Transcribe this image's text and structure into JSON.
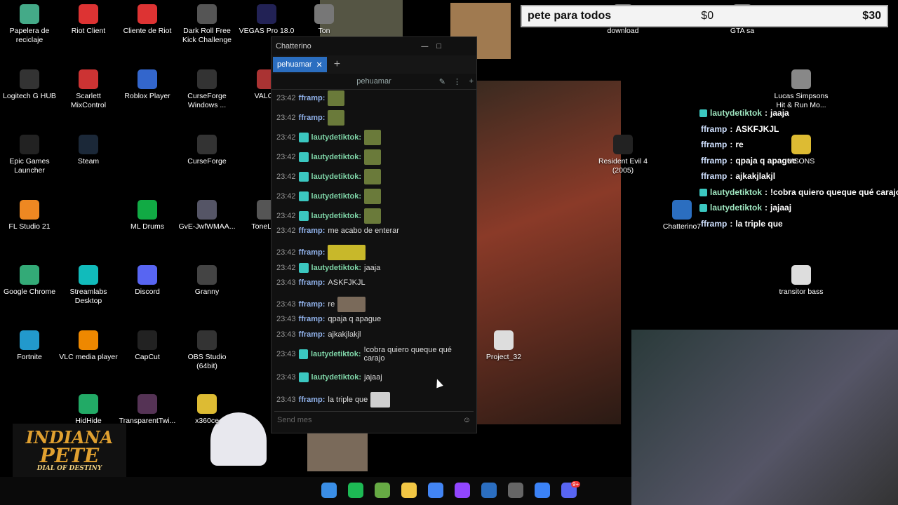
{
  "desktop_icons": [
    {
      "label": "Papelera de reciclaje",
      "icon": "recycle-bin-icon"
    },
    {
      "label": "Riot Client",
      "icon": "riot-icon"
    },
    {
      "label": "Cliente de Riot",
      "icon": "riot-icon"
    },
    {
      "label": "Dark Roll Free Kick Challenge",
      "icon": "soccer-icon"
    },
    {
      "label": "VEGAS Pro 18.0",
      "icon": "vegas-icon"
    },
    {
      "label": "Logitech G HUB",
      "icon": "logitech-icon"
    },
    {
      "label": "Scarlett MixControl",
      "icon": "scarlett-icon"
    },
    {
      "label": "Roblox Player",
      "icon": "roblox-icon"
    },
    {
      "label": "CurseForge Windows ...",
      "icon": "curseforge-icon"
    },
    {
      "label": "VALOR",
      "icon": "valorant-icon"
    },
    {
      "label": "Epic Games Launcher",
      "icon": "epic-icon"
    },
    {
      "label": "Steam",
      "icon": "steam-icon"
    },
    {
      "label": "CurseForge",
      "icon": "curseforge-icon"
    },
    {
      "label": "FL Studio 21",
      "icon": "flstudio-icon"
    },
    {
      "label": "ML Drums",
      "icon": "mldrums-icon"
    },
    {
      "label": "GvE-JwfWMAA...",
      "icon": "image-file-icon"
    },
    {
      "label": "ToneLib-I",
      "icon": "tonelib-icon"
    },
    {
      "label": "Google Chrome",
      "icon": "chrome-icon"
    },
    {
      "label": "Streamlabs Desktop",
      "icon": "streamlabs-icon"
    },
    {
      "label": "Discord",
      "icon": "discord-icon"
    },
    {
      "label": "Granny",
      "icon": "granny-icon"
    },
    {
      "label": "Fortnite",
      "icon": "fortnite-icon"
    },
    {
      "label": "VLC media player",
      "icon": "vlc-icon"
    },
    {
      "label": "CapCut",
      "icon": "capcut-icon"
    },
    {
      "label": "OBS Studio (64bit)",
      "icon": "obs-icon"
    },
    {
      "label": "HidHide",
      "icon": "hidhide-icon"
    },
    {
      "label": "TransparentTwi...",
      "icon": "twitch-icon"
    },
    {
      "label": "x360ce",
      "icon": "folder-icon"
    },
    {
      "label": "download",
      "icon": "file-icon"
    },
    {
      "label": "GTA sa",
      "icon": "file-icon"
    },
    {
      "label": "Lucas Simpsons Hit & Run Mo...",
      "icon": "shortcut-icon"
    },
    {
      "label": "Resident Evil 4 (2005)",
      "icon": "re4-icon"
    },
    {
      "label": "MSONS",
      "icon": "folder-icon"
    },
    {
      "label": "Chatterino7",
      "icon": "chatterino-icon"
    },
    {
      "label": "transitor bass",
      "icon": "audio-file-icon"
    },
    {
      "label": "Project_32",
      "icon": "video-file-icon"
    },
    {
      "label": "Ton",
      "icon": "file-icon"
    }
  ],
  "goal": {
    "name": "pete para todos",
    "current": "$0",
    "target": "$30"
  },
  "chatterino": {
    "title": "Chatterino",
    "tab": "pehuamar",
    "channel": "pehuamar",
    "input_placeholder": "Send mes",
    "messages": [
      {
        "time": "23:42",
        "user": "fframp",
        "text": "",
        "emote": "green",
        "badge": false
      },
      {
        "time": "23:42",
        "user": "fframp",
        "text": "",
        "emote": "green",
        "badge": false
      },
      {
        "time": "23:42",
        "user": "lautydetiktok",
        "text": "",
        "emote": "green",
        "badge": true
      },
      {
        "time": "23:42",
        "user": "lautydetiktok",
        "text": "",
        "emote": "green",
        "badge": true
      },
      {
        "time": "23:42",
        "user": "lautydetiktok",
        "text": "",
        "emote": "green",
        "badge": true
      },
      {
        "time": "23:42",
        "user": "lautydetiktok",
        "text": "",
        "emote": "green",
        "badge": true
      },
      {
        "time": "23:42",
        "user": "lautydetiktok",
        "text": "",
        "emote": "green",
        "badge": true
      },
      {
        "time": "23:42",
        "user": "fframp",
        "text": "me acabo de enterar",
        "emote": "",
        "badge": false
      },
      {
        "time": "23:42",
        "user": "fframp",
        "text": "",
        "emote": "yellow",
        "badge": false
      },
      {
        "time": "23:42",
        "user": "lautydetiktok",
        "text": "jaaja",
        "emote": "",
        "badge": true
      },
      {
        "time": "23:43",
        "user": "fframp",
        "text": "ASKFJKJL",
        "emote": "",
        "badge": false
      },
      {
        "time": "23:43",
        "user": "fframp",
        "text": "re",
        "emote": "grey",
        "badge": false
      },
      {
        "time": "23:43",
        "user": "fframp",
        "text": "qpaja q apague",
        "emote": "",
        "badge": false
      },
      {
        "time": "23:43",
        "user": "fframp",
        "text": "ajkakjlakjl",
        "emote": "",
        "badge": false
      },
      {
        "time": "23:43",
        "user": "lautydetiktok",
        "text": "!cobra quiero queque qué carajo",
        "emote": "",
        "badge": true
      },
      {
        "time": "23:43",
        "user": "lautydetiktok",
        "text": "jajaaj",
        "emote": "",
        "badge": true
      },
      {
        "time": "23:43",
        "user": "fframp",
        "text": "la triple que",
        "emote": "face",
        "badge": false
      }
    ]
  },
  "overlay_chat": [
    {
      "user": "lautydetiktok",
      "text": "jaaja",
      "badge": true
    },
    {
      "user": "fframp",
      "text": "ASKFJKJL",
      "badge": false
    },
    {
      "user": "fframp",
      "text": "re",
      "badge": false
    },
    {
      "user": "fframp",
      "text": "qpaja q apague",
      "badge": false
    },
    {
      "user": "fframp",
      "text": "ajkakjlakjl",
      "badge": false
    },
    {
      "user": "lautydetiktok",
      "text": "!cobra quiero queque qué carajo",
      "badge": true
    },
    {
      "user": "lautydetiktok",
      "text": "jajaaj",
      "badge": true
    },
    {
      "user": "fframp",
      "text": "la triple que",
      "badge": false
    }
  ],
  "overlay_logo": {
    "line1": "INDIANA",
    "line2": "PETE",
    "line3": "DIAL OF DESTINY"
  },
  "taskbar": [
    "start-icon",
    "spotify-icon",
    "app-icon",
    "file-explorer-icon",
    "chrome-icon",
    "twitch-icon",
    "chatterino-icon",
    "obs-icon",
    "app-icon",
    "discord-icon"
  ],
  "discord_badge": "9+",
  "colors": {
    "tab": "#2b6ec0",
    "badge": "#3bc7c0",
    "goal_bg": "#f3f3f3"
  }
}
